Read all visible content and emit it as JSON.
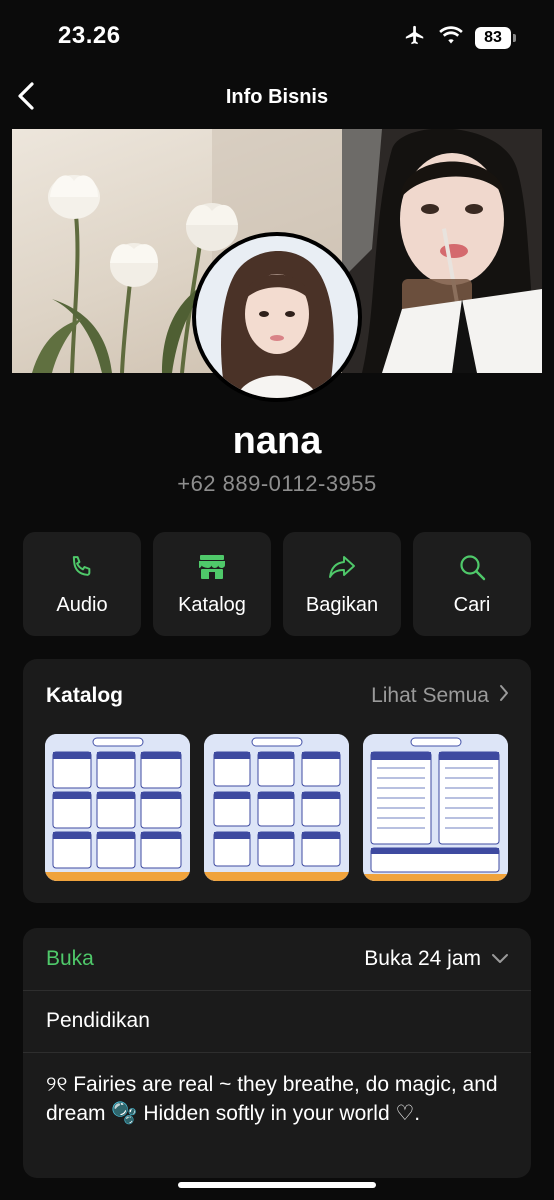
{
  "status_bar": {
    "time": "23.26",
    "battery": "83",
    "icons": [
      "airplane-icon",
      "wifi-icon",
      "battery-icon"
    ]
  },
  "header": {
    "title": "Info Bisnis",
    "back_icon": "chevron-left-icon"
  },
  "profile": {
    "name": "nana",
    "phone": "+62 889-0112-3955"
  },
  "actions": [
    {
      "label": "Audio",
      "icon": "phone-icon"
    },
    {
      "label": "Katalog",
      "icon": "store-icon"
    },
    {
      "label": "Bagikan",
      "icon": "share-icon"
    },
    {
      "label": "Cari",
      "icon": "search-icon"
    }
  ],
  "catalog": {
    "title": "Katalog",
    "see_all": "Lihat Semua"
  },
  "business": {
    "status": "Buka",
    "hours": "Buka 24 jam",
    "category": "Pendidikan",
    "description": "୨୧ Fairies are real ~ they breathe, do magic, and dream 🫧 Hidden softly in your world ♡."
  },
  "colors": {
    "accent": "#4fc96a",
    "background": "#0b0b0b",
    "card": "#1b1b1b"
  }
}
